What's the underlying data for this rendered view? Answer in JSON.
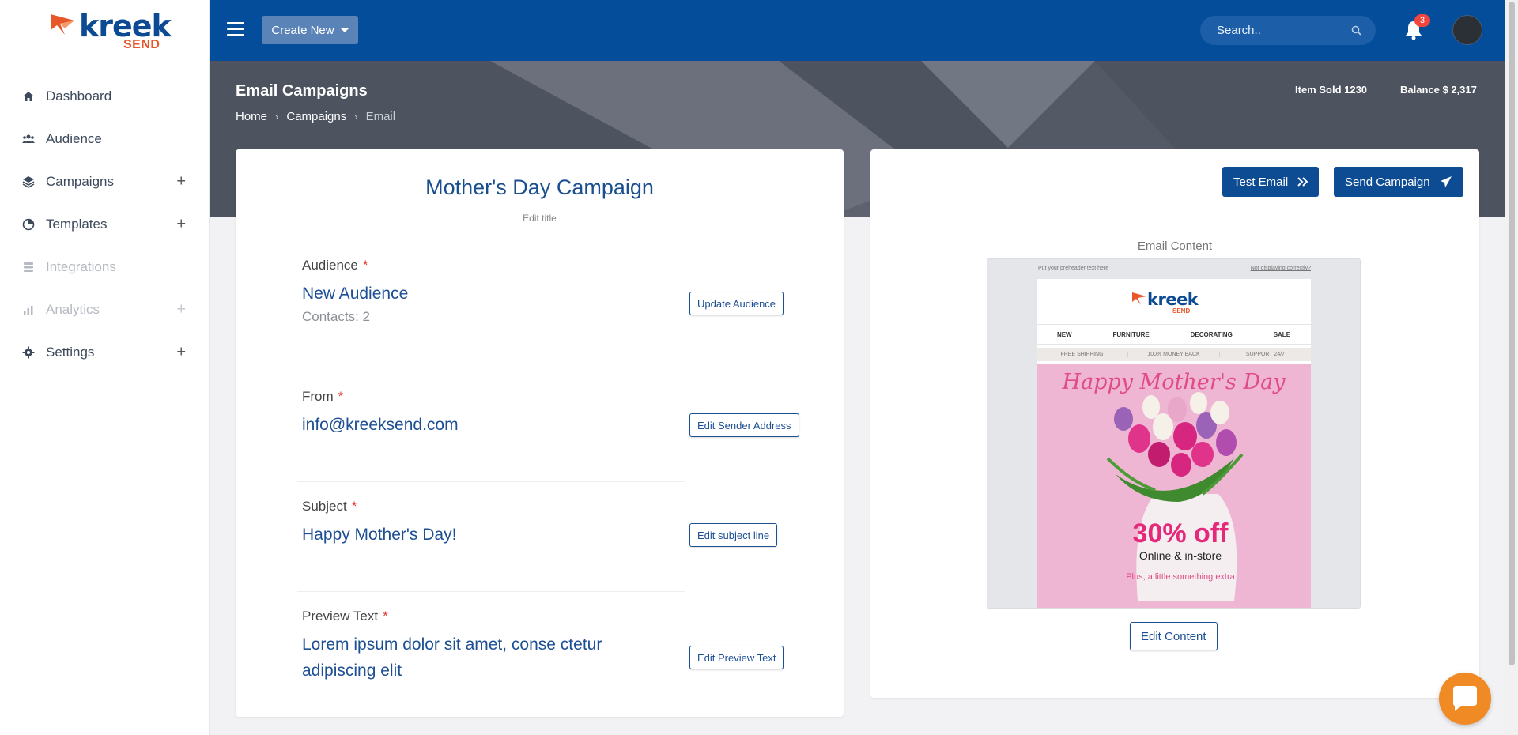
{
  "brand": {
    "word": "kreek",
    "sub": "SEND"
  },
  "sidebar": {
    "items": [
      {
        "label": "Dashboard"
      },
      {
        "label": "Audience"
      },
      {
        "label": "Campaigns"
      },
      {
        "label": "Templates"
      },
      {
        "label": "Integrations"
      },
      {
        "label": "Analytics"
      },
      {
        "label": "Settings"
      }
    ]
  },
  "topbar": {
    "create_new": "Create New",
    "search_placeholder": "Search..",
    "notification_count": "3"
  },
  "header": {
    "title": "Email Campaigns",
    "breadcrumb": [
      "Home",
      "Campaigns",
      "Email"
    ],
    "item_sold": "Item Sold 1230",
    "balance": "Balance $ 2,317"
  },
  "campaign": {
    "title": "Mother's Day Campaign",
    "edit_title": "Edit title",
    "audience": {
      "label": "Audience",
      "value": "New Audience",
      "contacts": "Contacts: 2",
      "button": "Update Audience"
    },
    "from": {
      "label": "From",
      "value": "info@kreeksend.com",
      "button": "Edit Sender Address"
    },
    "subject": {
      "label": "Subject",
      "value": "Happy Mother's Day!",
      "button": "Edit subject line"
    },
    "preview": {
      "label": "Preview Text",
      "value": "Lorem ipsum dolor sit amet, conse ctetur adipiscing elit",
      "button": "Edit Preview Text"
    },
    "required_mark": "*"
  },
  "preview_panel": {
    "test_email": "Test Email",
    "send_campaign": "Send Campaign",
    "content_label": "Email Content",
    "edit_content": "Edit Content",
    "email": {
      "preheader": "Put your preheader text here",
      "not_displaying": "Not displaying correctly?",
      "nav": [
        "NEW",
        "FURNITURE",
        "DECORATING",
        "SALE"
      ],
      "shipping": [
        "FREE SHIPPING",
        "100% MONEY BACK",
        "SUPPORT 24/7"
      ],
      "headline": "Happy Mother's Day",
      "offer": "30% off",
      "online": "Online & in-store",
      "extra": "Plus, a little something extra"
    }
  },
  "colors": {
    "primary": "#044d9b",
    "accent": "#e8572a",
    "hero": "#4d535f",
    "chat": "#f08a24"
  }
}
